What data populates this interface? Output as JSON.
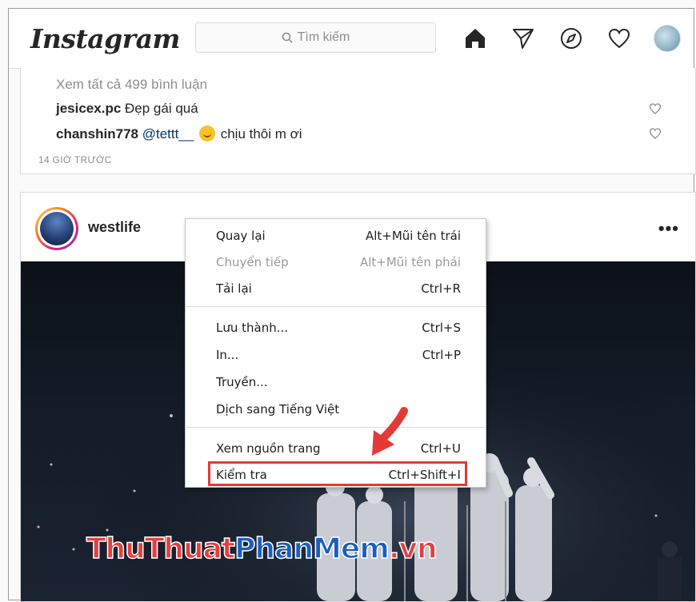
{
  "header": {
    "logo": "Instagram",
    "search_placeholder": "Tìm kiếm",
    "nav_icons": [
      "home-icon",
      "send-icon",
      "explore-icon",
      "heart-icon",
      "profile-avatar"
    ]
  },
  "previous_post": {
    "view_all_comments": "Xem tất cả 499 bình luận",
    "comments": [
      {
        "user": "jesicex.pc",
        "text": "Đẹp gái quá"
      },
      {
        "user": "chanshin778",
        "mention": "@tettt__",
        "emoji": "rofl-emoji",
        "text": "chịu thôi m ơi"
      }
    ],
    "timestamp": "14 GIỜ TRƯỚC"
  },
  "post": {
    "username": "westlife",
    "more_label": "•••"
  },
  "context_menu": {
    "items": [
      {
        "label": "Quay lại",
        "shortcut": "Alt+Mũi tên trái",
        "enabled": true
      },
      {
        "label": "Chuyển tiếp",
        "shortcut": "Alt+Mũi tên phải",
        "enabled": false
      },
      {
        "label": "Tải lại",
        "shortcut": "Ctrl+R",
        "enabled": true
      },
      {
        "label": "Lưu thành...",
        "shortcut": "Ctrl+S",
        "enabled": true
      },
      {
        "label": "In...",
        "shortcut": "Ctrl+P",
        "enabled": true
      },
      {
        "label": "Truyền...",
        "shortcut": "",
        "enabled": true
      },
      {
        "label": "Dịch sang Tiếng Việt",
        "shortcut": "",
        "enabled": true
      },
      {
        "label": "Xem nguồn trang",
        "shortcut": "Ctrl+U",
        "enabled": true
      },
      {
        "label": "Kiểm tra",
        "shortcut": "Ctrl+Shift+I",
        "enabled": true,
        "highlighted": true
      }
    ]
  },
  "watermark": {
    "part1": "ThuThuat",
    "part2": "PhanMem",
    "part3": ".vn"
  },
  "colors": {
    "highlight": "#e53935",
    "mention": "#00376b",
    "muted": "#8e8e8e"
  }
}
